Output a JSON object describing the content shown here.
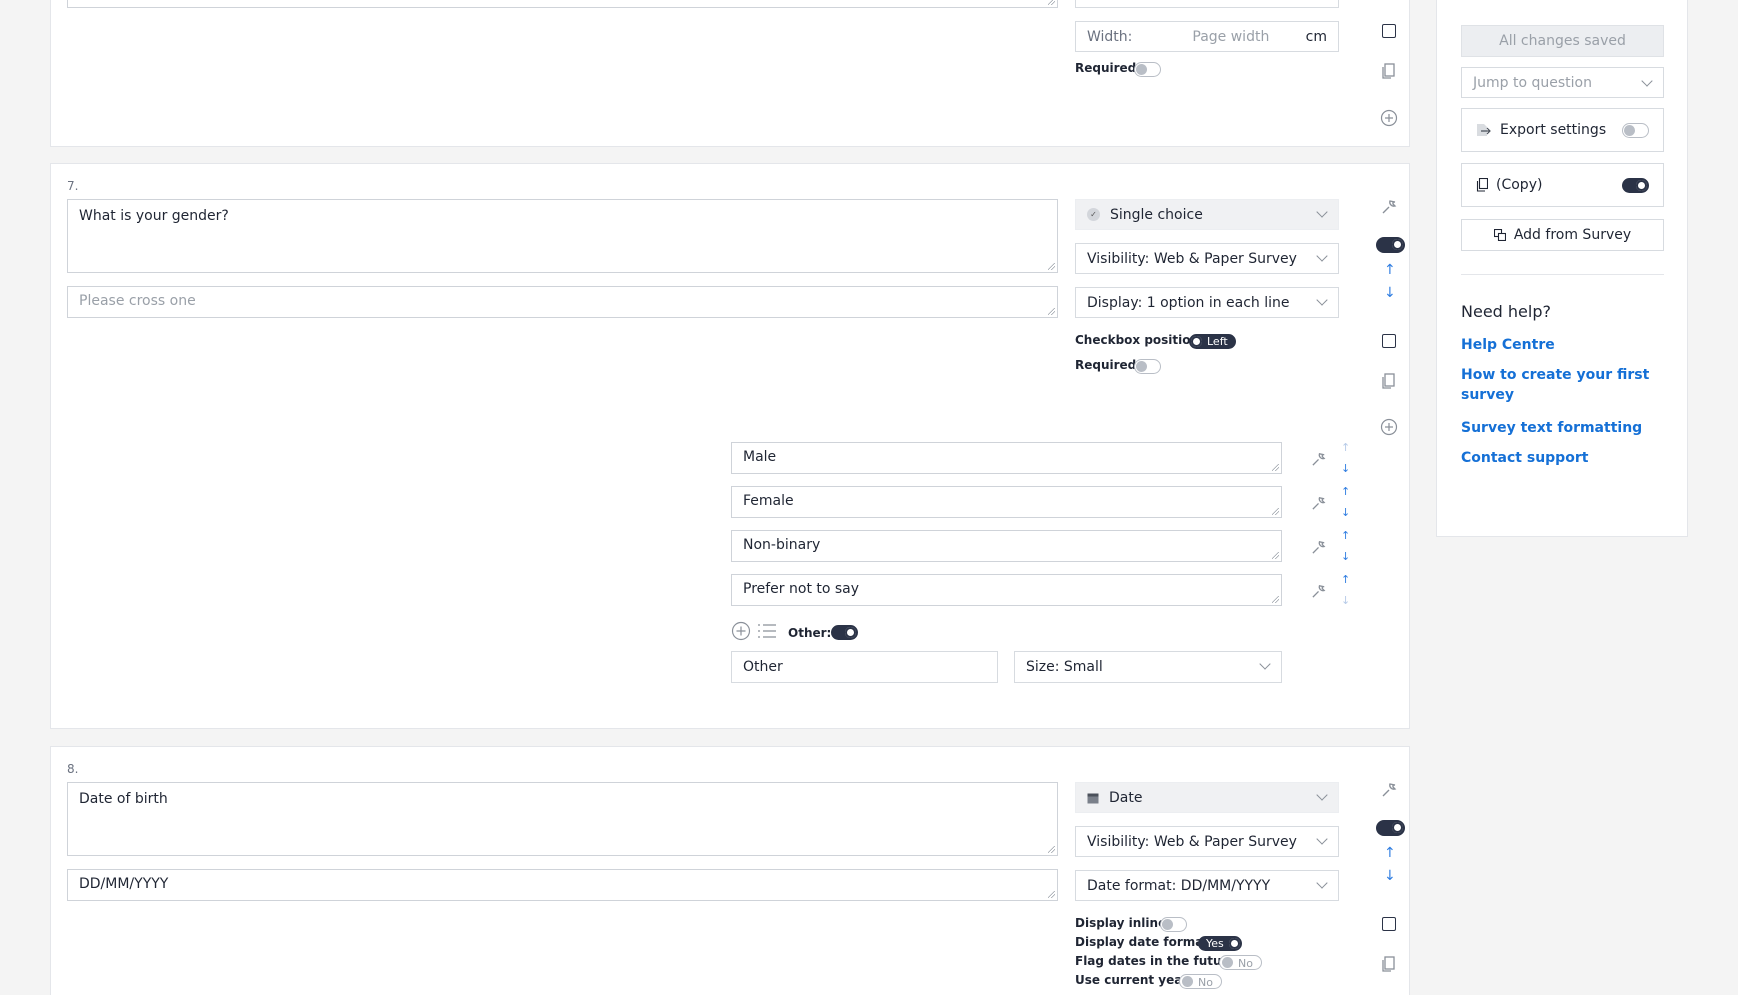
{
  "q6": {
    "width_label": "Width:",
    "width_placeholder": "Page width",
    "width_unit": "cm",
    "required_label": "Required:"
  },
  "q7": {
    "number": "7.",
    "question": "What is your gender?",
    "hint_placeholder": "Please cross one",
    "type": "Single choice",
    "visibility": "Visibility: Web & Paper Survey",
    "display": "Display: 1 option in each line",
    "checkbox_position_label": "Checkbox position:",
    "checkbox_position_value": "Left",
    "required_label": "Required:",
    "options": [
      {
        "label": "Male"
      },
      {
        "label": "Female"
      },
      {
        "label": "Non-binary"
      },
      {
        "label": "Prefer not to say"
      }
    ],
    "other_label": "Other:",
    "other_text": "Other",
    "size": "Size: Small"
  },
  "q8": {
    "number": "8.",
    "question": "Date of birth",
    "hint": "DD/MM/YYYY",
    "type": "Date",
    "visibility": "Visibility: Web & Paper Survey",
    "date_format": "Date format: DD/MM/YYYY",
    "display_inline_label": "Display inline:",
    "display_date_format_label": "Display date format:",
    "display_date_format_value": "Yes",
    "flag_future_label": "Flag dates in the future:",
    "flag_future_value": "No",
    "use_current_year_label": "Use current year:",
    "use_current_year_value": "No"
  },
  "sidebar": {
    "saved_status": "All changes saved",
    "jump_placeholder": "Jump to question",
    "export_settings": "Export settings",
    "copy": "(Copy)",
    "add_from_survey": "Add from Survey",
    "help_title": "Need help?",
    "links": [
      "Help Centre",
      "How to create your first survey",
      "Survey text formatting",
      "Contact support"
    ]
  },
  "colors": {
    "accent": "#2f7de1",
    "toggle_dark": "#2b3347",
    "link": "#1570d6"
  }
}
